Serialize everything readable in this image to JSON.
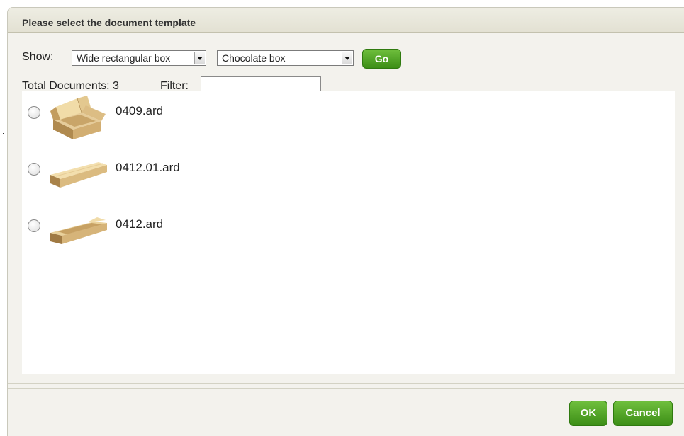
{
  "dialog": {
    "title": "Please select the document template"
  },
  "toolbar": {
    "show_label": "Show:",
    "filter1_value": "Wide rectangular box",
    "filter2_value": "Chocolate box",
    "go_label": "Go"
  },
  "summary": {
    "total_label": "Total Documents: 3",
    "filter_label": "Filter:",
    "filter_value": ""
  },
  "documents": [
    {
      "name": "0409.ard",
      "icon": "open-box-icon",
      "selected": false
    },
    {
      "name": "0412.01.ard",
      "icon": "flat-box-icon",
      "selected": false
    },
    {
      "name": "0412.ard",
      "icon": "flat-box-icon",
      "selected": false
    }
  ],
  "footer": {
    "ok_label": "OK",
    "cancel_label": "Cancel"
  },
  "colors": {
    "accent_green": "#3c8e16",
    "dialog_bg": "#f3f2ed",
    "titlebar_bg": "#e3e1d3"
  }
}
